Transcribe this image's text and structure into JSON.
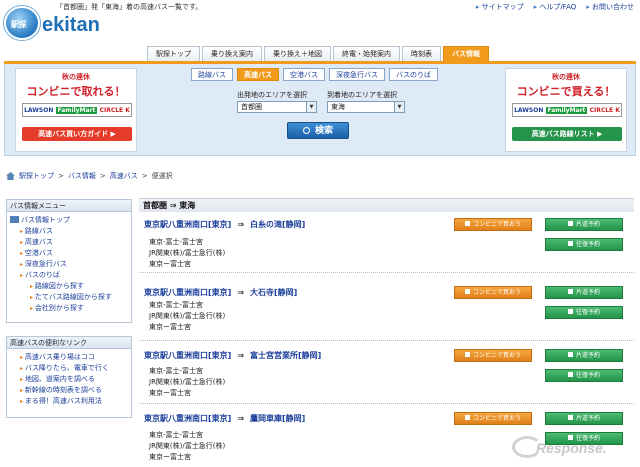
{
  "header": {
    "tagline": "「首都圏」発「東海」着の高速バス一覧です。",
    "logo_badge": "駅探",
    "logo_text": "ekitan",
    "links": [
      {
        "label": "サイトマップ"
      },
      {
        "label": "ヘルプ/FAQ"
      },
      {
        "label": "お問い合わせ"
      }
    ]
  },
  "nav": {
    "tabs": [
      {
        "label": "駅探トップ",
        "active": false
      },
      {
        "label": "乗り換え案内",
        "active": false
      },
      {
        "label": "乗り換え＋地図",
        "active": false
      },
      {
        "label": "終電・始発案内",
        "active": false
      },
      {
        "label": "時刻表",
        "active": false
      },
      {
        "label": "バス情報",
        "active": true
      }
    ]
  },
  "search": {
    "subtabs": [
      {
        "label": "路線バス",
        "active": false
      },
      {
        "label": "高速バス",
        "active": true
      },
      {
        "label": "空港バス",
        "active": false
      },
      {
        "label": "深夜急行バス",
        "active": false
      },
      {
        "label": "バスのりば",
        "active": false
      }
    ],
    "from_label": "出発地のエリアを選択",
    "to_label": "到着地のエリアを選択",
    "from_value": "首都圏",
    "to_value": "東海",
    "button_label": "検索"
  },
  "ads": {
    "left": {
      "line1": "秋の連休",
      "line2": "コンビニで取れる！",
      "shop1": "LAWSON",
      "shop2": "FamilyMart",
      "shop3": "CIRCLE K",
      "cta": "高速バス買い方ガイド ▶"
    },
    "right": {
      "line1": "秋の連休",
      "line2": "コンビニで買える！",
      "shop1": "LAWSON",
      "shop2": "FamilyMart",
      "shop3": "CIRCLE K",
      "cta": "高速バス路線リスト ▶"
    }
  },
  "breadcrumb": {
    "items": [
      "駅探トップ",
      "バス情報",
      "高速バス",
      "便選択"
    ],
    "sep": " > "
  },
  "sidebar": {
    "menu_title": "バス情報メニュー",
    "menu_items": [
      {
        "label": "バス情報トップ",
        "level": 0
      },
      {
        "label": "路線バス",
        "level": 1
      },
      {
        "label": "高速バス",
        "level": 1
      },
      {
        "label": "空港バス",
        "level": 1
      },
      {
        "label": "深夜急行バス",
        "level": 1
      },
      {
        "label": "バスのりば",
        "level": 1
      },
      {
        "label": "路線図から探す",
        "level": 2
      },
      {
        "label": "たてバス路線図から探す",
        "level": 2
      },
      {
        "label": "会社別から探す",
        "level": 2
      }
    ],
    "links_title": "高速バスの便利なリンク",
    "link_items": [
      {
        "label": "高速バス乗り場はココ"
      },
      {
        "label": "バス降りたら、電車で行く"
      },
      {
        "label": "地図、道案内を調べる"
      },
      {
        "label": "新幹線の時刻表を調べる"
      },
      {
        "label": "まる得！高速バス利用法"
      }
    ]
  },
  "main": {
    "route_heading": "首都圏 ⇒ 東海",
    "btn_convenience": "コンビニで買おう",
    "btn_oneway": "片道予約",
    "btn_roundtrip": "往復予約",
    "results": [
      {
        "from": "東京駅八重洲南口[東京]",
        "arrow": "⇒",
        "to": "白糸の滝[静岡]",
        "line1": "東京-富士-富士宮",
        "line2": "JR関東(株)/富士急行(株)",
        "line3": "東京ー富士宮"
      },
      {
        "from": "東京駅八重洲南口[東京]",
        "arrow": "⇒",
        "to": "大石寺[静岡]",
        "line1": "東京-富士-富士宮",
        "line2": "JR関東(株)/富士急行(株)",
        "line3": "東京ー富士宮"
      },
      {
        "from": "東京駅八重洲南口[東京]",
        "arrow": "⇒",
        "to": "富士宮営業所[静岡]",
        "line1": "東京-富士-富士宮",
        "line2": "JR関東(株)/富士急行(株)",
        "line3": "東京ー富士宮"
      },
      {
        "from": "東京駅八重洲南口[東京]",
        "arrow": "⇒",
        "to": "鷹岡車庫[静岡]",
        "line1": "東京-富士-富士宮",
        "line2": "JR関東(株)/富士急行(株)",
        "line3": "東京ー富士宮"
      }
    ]
  },
  "watermark": "Response."
}
